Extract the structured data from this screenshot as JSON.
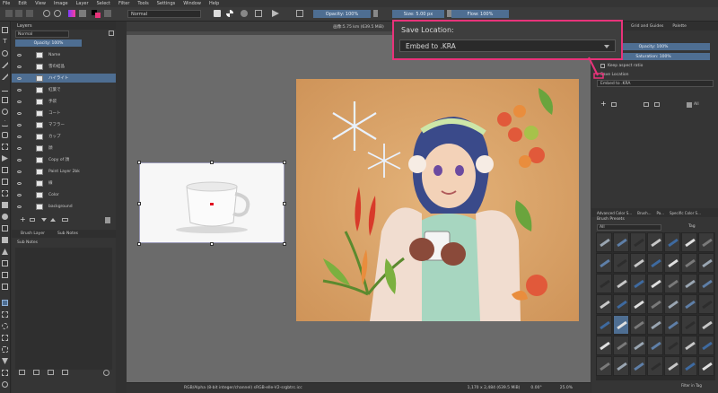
{
  "menu": [
    "File",
    "Edit",
    "View",
    "Image",
    "Layer",
    "Select",
    "Filter",
    "Tools",
    "Settings",
    "Window",
    "Help"
  ],
  "toolbar": {
    "blend_mode": "Normal",
    "opacity": "Opacity: 100%",
    "size": "Size: 5.00 px",
    "flow": "Flow: 100%"
  },
  "layers": {
    "title": "Layers",
    "blend": "Normal",
    "opacity": "Opacity: 100%",
    "rows": [
      {
        "name": "Name",
        "selected": false
      },
      {
        "name": "雪の結晶",
        "selected": false
      },
      {
        "name": "ハイライト",
        "selected": true
      },
      {
        "name": "紅葉で",
        "selected": false
      },
      {
        "name": "手袋",
        "selected": false
      },
      {
        "name": "コート",
        "selected": false
      },
      {
        "name": "マフラー",
        "selected": false
      },
      {
        "name": "カップ",
        "selected": false
      },
      {
        "name": "顔",
        "selected": false
      },
      {
        "name": "Copy of 顔",
        "selected": false
      },
      {
        "name": "Paint Layer 2bk",
        "selected": false
      },
      {
        "name": "線",
        "selected": false
      },
      {
        "name": "Color",
        "selected": false
      },
      {
        "name": "background",
        "selected": false
      }
    ],
    "tabs": [
      "Brush Layer",
      "Sub Notes"
    ],
    "notes_title": "Sub Notes"
  },
  "document": {
    "tab": "画像:5.75 km (639.5 MiB)"
  },
  "popup": {
    "label": "Save Location:",
    "value": "Embed to .KRA"
  },
  "right": {
    "tabs_top": [
      "Grid and Guides",
      "Palette"
    ],
    "opacity": "Opacity: 100%",
    "saturation": "Saturation: 100%",
    "keep_aspect": "Keep aspect ratio",
    "save_location": "Save Location",
    "embed": "Embed to .KRA",
    "mid_tabs": [
      "Advanced Color S...",
      "Brush...",
      "Pa...",
      "Specific Color S..."
    ],
    "brush_presets_title": "Brush Presets",
    "brush_filter": "All",
    "brush_tag": "Tag",
    "filter_in_tag": "Filter in Tag"
  },
  "status": {
    "left": "RGB/Alpha (8-bit integer/channel)  sRGB-elle-V2-srgbtrc.icc",
    "size": "1,170 x 2,484 (639.5 MiB)",
    "angle": "0.00°",
    "zoom": "25.0%"
  },
  "colors": {
    "accent": "#e8337a",
    "selection": "#4e6e92",
    "artwork_bg": "#d9a066"
  }
}
